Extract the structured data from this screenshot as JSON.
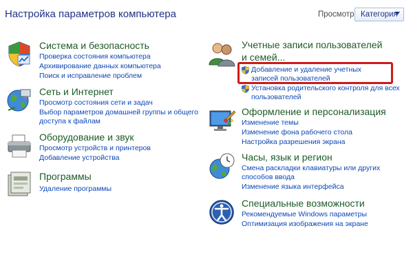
{
  "header": {
    "title": "Настройка параметров компьютера",
    "view_label": "Просмотр:",
    "view_value": "Категория"
  },
  "left": [
    {
      "icon": "security-shield-icon",
      "title": "Система и безопасность",
      "links": [
        "Проверка состояния компьютера",
        "Архивирование данных компьютера",
        "Поиск и исправление проблем"
      ]
    },
    {
      "icon": "network-globe-icon",
      "title": "Сеть и Интернет",
      "links": [
        "Просмотр состояния сети и задач",
        "Выбор параметров домашней группы и общего доступа к файлам"
      ]
    },
    {
      "icon": "printer-icon",
      "title": "Оборудование и звук",
      "links": [
        "Просмотр устройств и принтеров",
        "Добавление устройства"
      ]
    },
    {
      "icon": "programs-icon",
      "title": "Программы",
      "links": [
        "Удаление программы"
      ]
    }
  ],
  "right": [
    {
      "icon": "users-icon",
      "title": "Учетные записи пользователей и семей...",
      "links": [
        "Добавление и удаление учетных записей пользователей",
        "Установка родительского контроля для всех пользователей"
      ]
    },
    {
      "icon": "monitor-paint-icon",
      "title": "Оформление и персонализация",
      "links": [
        "Изменение темы",
        "Изменение фона рабочего стола",
        "Настройка разрешения экрана"
      ]
    },
    {
      "icon": "clock-globe-icon",
      "title": "Часы, язык и регион",
      "links": [
        "Смена раскладки клавиатуры или других способов ввода",
        "Изменение языка интерфейса"
      ]
    },
    {
      "icon": "accessibility-icon",
      "title": "Специальные возможности",
      "links": [
        "Рекомендуемые Windows параметры",
        "Оптимизация изображения на экране"
      ]
    }
  ]
}
